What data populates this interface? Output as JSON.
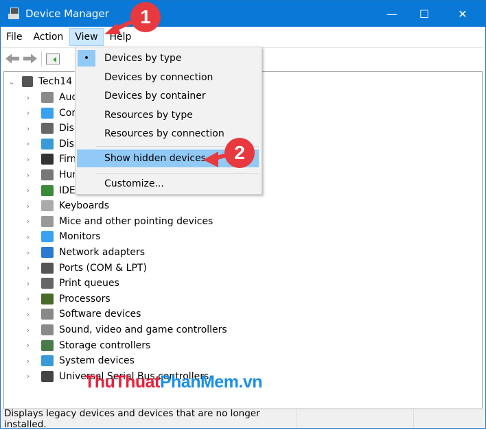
{
  "window": {
    "title": "Device Manager",
    "minimize": "—",
    "maximize": "☐",
    "close": "✕"
  },
  "menubar": [
    "File",
    "Action",
    "View",
    "Help"
  ],
  "tree": {
    "root": "Tech14",
    "items": [
      {
        "label": "Aud",
        "color": "#8a8a8a"
      },
      {
        "label": "Com",
        "color": "#3aa0f0"
      },
      {
        "label": "Disk",
        "color": "#666"
      },
      {
        "label": "Disp",
        "color": "#3a9ad8"
      },
      {
        "label": "Firm",
        "color": "#333"
      },
      {
        "label": "Hum",
        "color": "#777"
      },
      {
        "label": "IDE",
        "color": "#3a8a3a"
      },
      {
        "label": "Keyboards",
        "color": "#aaa"
      },
      {
        "label": "Mice and other pointing devices",
        "color": "#999"
      },
      {
        "label": "Monitors",
        "color": "#3aa0f0"
      },
      {
        "label": "Network adapters",
        "color": "#2a7ad0"
      },
      {
        "label": "Ports (COM & LPT)",
        "color": "#555"
      },
      {
        "label": "Print queues",
        "color": "#666"
      },
      {
        "label": "Processors",
        "color": "#4a6a2a"
      },
      {
        "label": "Software devices",
        "color": "#888"
      },
      {
        "label": "Sound, video and game controllers",
        "color": "#8a8a8a"
      },
      {
        "label": "Storage controllers",
        "color": "#4a7a4a"
      },
      {
        "label": "System devices",
        "color": "#3a9ad8"
      },
      {
        "label": "Universal Serial Bus controllers",
        "color": "#444"
      }
    ]
  },
  "view_menu": {
    "items": [
      "Devices by type",
      "Devices by connection",
      "Devices by container",
      "Resources by type",
      "Resources by connection"
    ],
    "selected_bullet": "•",
    "highlighted": "Show hidden devices",
    "customize": "Customize..."
  },
  "annotations": {
    "step1": "1",
    "step2": "2"
  },
  "watermark": {
    "part1": "ThuThuat",
    "part2": "PhanMem.vn"
  },
  "status": "Displays legacy devices and devices that are no longer installed."
}
